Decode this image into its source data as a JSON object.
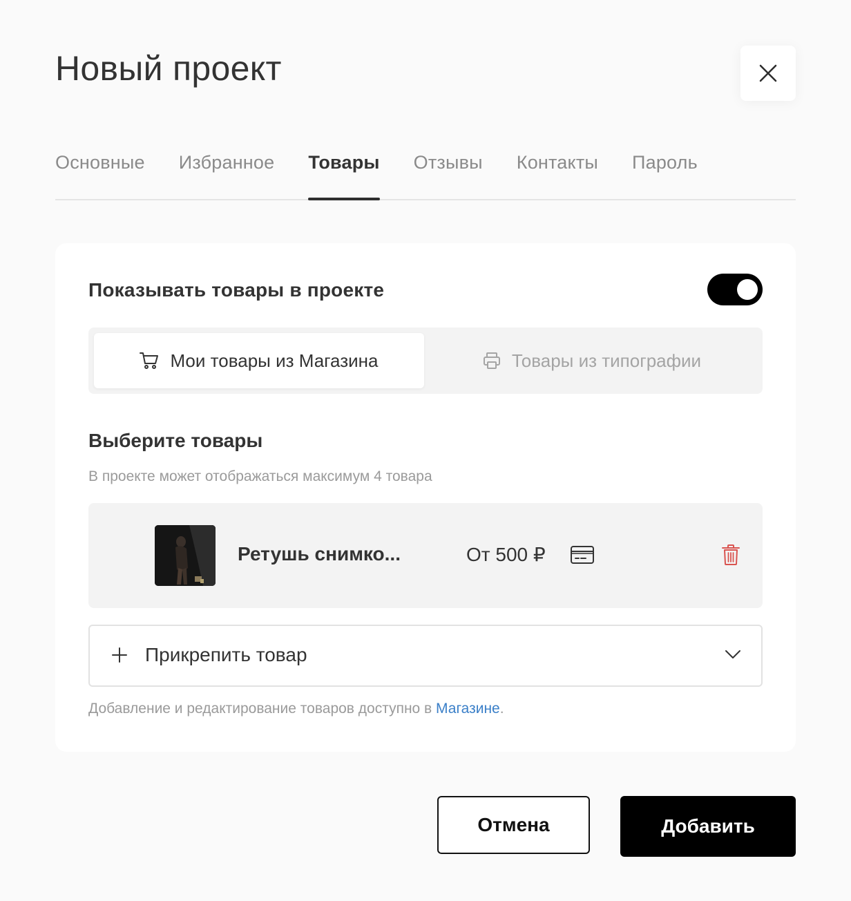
{
  "dialog": {
    "title": "Новый проект",
    "close_icon": "close-icon"
  },
  "tabs": [
    {
      "label": "Основные",
      "active": false
    },
    {
      "label": "Избранное",
      "active": false
    },
    {
      "label": "Товары",
      "active": true
    },
    {
      "label": "Отзывы",
      "active": false
    },
    {
      "label": "Контакты",
      "active": false
    },
    {
      "label": "Пароль",
      "active": false
    }
  ],
  "products_card": {
    "toggle_label": "Показывать товары в проекте",
    "toggle_on": true,
    "source_options": [
      {
        "label": "Мои товары из Магазина",
        "icon": "cart-icon",
        "active": true
      },
      {
        "label": "Товары из типографии",
        "icon": "printer-icon",
        "active": false
      }
    ],
    "section_title": "Выберите товары",
    "section_subtitle": "В проекте может отображаться максимум 4 товара",
    "items": [
      {
        "name": "Ретушь снимко...",
        "price": "От 500 ₽",
        "payment_icon": "credit-card-icon",
        "delete_icon": "trash-icon"
      }
    ],
    "attach": {
      "label": "Прикрепить товар",
      "plus_icon": "plus-icon",
      "chevron_icon": "chevron-down-icon"
    },
    "footnote": {
      "text": "Добавление и редактирование товаров доступно в ",
      "link_text": "Магазине",
      "suffix": "."
    }
  },
  "actions": {
    "cancel_label": "Отмена",
    "submit_label": "Добавить"
  },
  "colors": {
    "background": "#fafafa",
    "accent": "#000000",
    "link": "#3a7fc8",
    "danger": "#d9534f"
  }
}
